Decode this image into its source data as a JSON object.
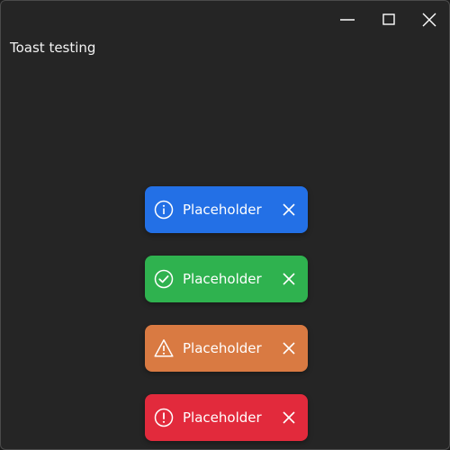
{
  "window": {
    "title": "Toast testing",
    "buttons": [
      "minimize",
      "maximize",
      "close"
    ]
  },
  "toasts": [
    {
      "type": "info",
      "text": "Placeholder",
      "color": "#2370e6",
      "icon": "info-icon"
    },
    {
      "type": "success",
      "text": "Placeholder",
      "color": "#2fb24f",
      "icon": "check-circle-icon"
    },
    {
      "type": "warning",
      "text": "Placeholder",
      "color": "#d97a42",
      "icon": "warning-triangle-icon"
    },
    {
      "type": "error",
      "text": "Placeholder",
      "color": "#e22a3c",
      "icon": "error-circle-icon"
    }
  ]
}
